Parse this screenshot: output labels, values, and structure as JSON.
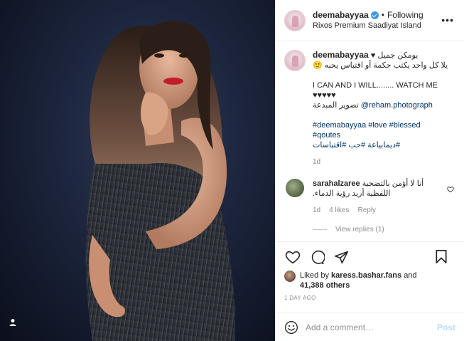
{
  "header": {
    "username": "deemabayyaa",
    "follow_label": "Following",
    "location": "Rixos Premium Saadiyat Island",
    "more_label": "•••"
  },
  "caption": {
    "username": "deemabayyaa",
    "line1": "يومكن جميل ♥",
    "line2": "يلا كل واحد يكتب حكمة أو اقتباس يحبه 🙂",
    "line3": "I CAN AND I WILL........ WATCH ME",
    "line4": "♥♥♥♥♥",
    "photographer_label": "تصوير المبدعة",
    "photographer_tag": "@reham.photograph",
    "hashtags_line1": "#deemabayyaa #love #blessed",
    "hashtags_line2": "#qoutes",
    "hashtags_line3": "#ديمابياعة #حب #اقتباسات",
    "age": "1d"
  },
  "comment": {
    "username": "sarahalzaree",
    "text_line1": "أنا لا أؤمن بالتضحية",
    "text_line2": "اللفظية أريد رؤية الدماء.",
    "age": "1d",
    "likes": "4 likes",
    "reply_label": "Reply",
    "view_replies": "View replies (1)"
  },
  "actions": {
    "liked_by_prefix": "Liked by",
    "liked_by_user": "karess.bashar.fans",
    "liked_by_and": "and",
    "others": "41,388 others",
    "time": "1 DAY AGO"
  },
  "add_comment": {
    "placeholder": "Add a comment…",
    "post_label": "Post"
  },
  "colors": {
    "verified": "#3897f0",
    "link": "#003569",
    "muted": "#8e8e8e",
    "post_disabled": "#b2dffc"
  }
}
